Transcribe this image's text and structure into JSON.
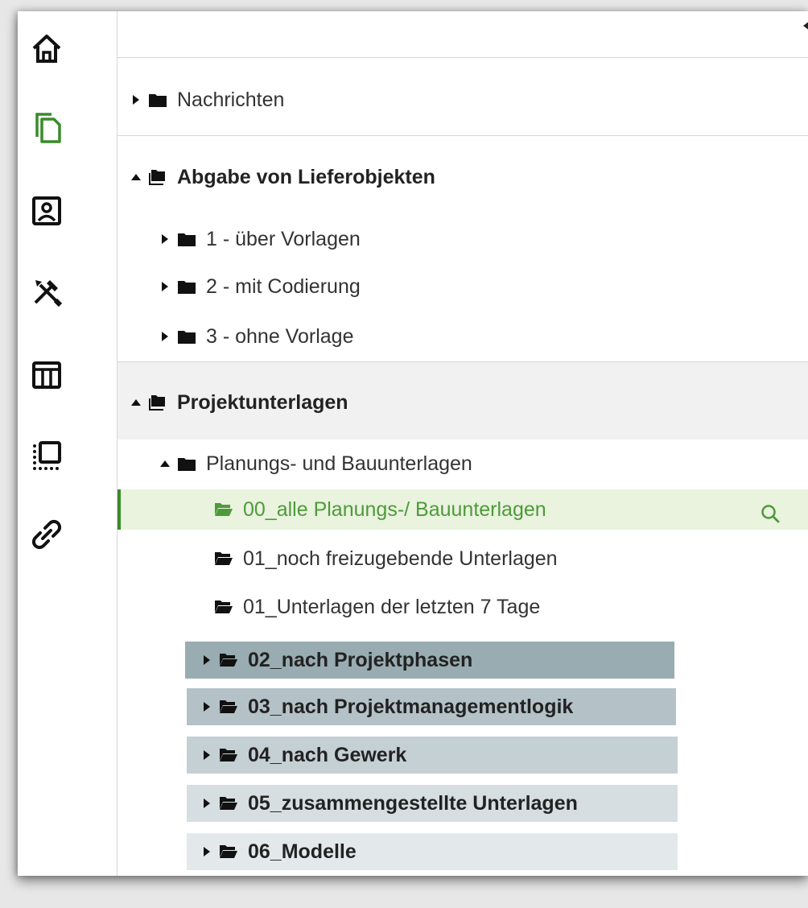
{
  "rail": {
    "icons": [
      "home-icon",
      "documents-icon",
      "contact-card-icon",
      "tools-icon",
      "table-layout-icon",
      "selection-icon",
      "link-icon"
    ],
    "active_color": "#3a8a2c"
  },
  "tree": {
    "nachrichten": "Nachrichten",
    "abgabe": {
      "label": "Abgabe von Lieferobjekten",
      "children": [
        "1 - über Vorlagen",
        "2 - mit Codierung",
        "3 - ohne Vorlage"
      ]
    },
    "projektunterlagen": {
      "label": "Projektunterlagen",
      "planung": {
        "label": "Planungs- und Bauunterlagen",
        "views": [
          "00_alle Planungs-/ Bauunterlagen",
          "01_noch freizugebende Unterlagen",
          "01_Unterlagen der letzten 7 Tage"
        ],
        "groups": [
          "02_nach Projektphasen",
          "03_nach Projektmanagementlogik",
          "04_nach Gewerk",
          "05_zusammengestellte Unterlagen",
          "06_Modelle"
        ]
      }
    }
  },
  "colors": {
    "selected_text": "#4e9a3a",
    "selected_bg": "#e9f3de",
    "group_bg_1": "#98acb2",
    "group_bg_2": "#b4c2c7",
    "group_bg_3": "#c4d0d4",
    "group_bg_4": "#d6dee1",
    "group_bg_5": "#e3e9eb"
  }
}
